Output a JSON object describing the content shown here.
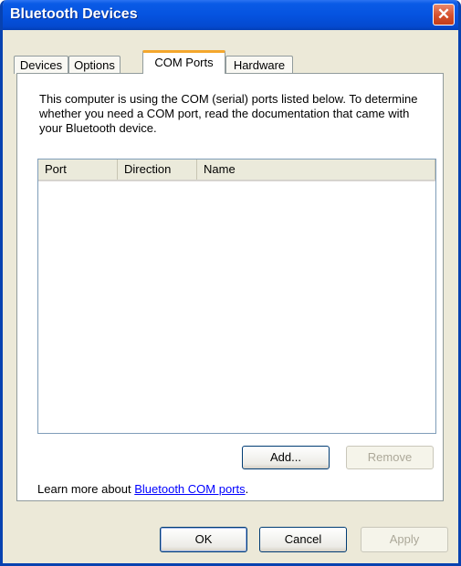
{
  "window": {
    "title": "Bluetooth Devices",
    "close_glyph": "✕",
    "close_icon": "close-icon"
  },
  "tabs": [
    {
      "label": "Devices",
      "selected": false
    },
    {
      "label": "Options",
      "selected": false
    },
    {
      "label": "COM Ports",
      "selected": true
    },
    {
      "label": "Hardware",
      "selected": false
    }
  ],
  "com_ports": {
    "description": "This computer is using the COM (serial) ports listed below. To determine whether you need a COM port, read the documentation that came with your Bluetooth device.",
    "columns": [
      "Port",
      "Direction",
      "Name"
    ],
    "rows": [],
    "add_label": "Add...",
    "remove_label": "Remove",
    "learn_prefix": "Learn more about ",
    "learn_link": "Bluetooth COM ports",
    "learn_suffix": "."
  },
  "footer": {
    "ok_label": "OK",
    "cancel_label": "Cancel",
    "apply_label": "Apply"
  },
  "colors": {
    "titlebar": "#0553e0",
    "dialog_bg": "#ece9d8",
    "selected_tab_accent": "#f4a72d",
    "link": "#0000ff"
  }
}
